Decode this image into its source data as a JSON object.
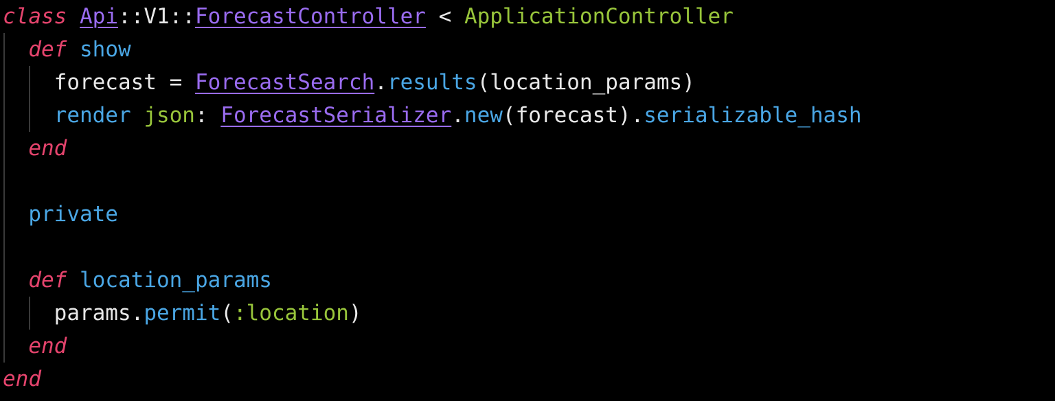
{
  "colors": {
    "background": "#000000",
    "keyword": "#e5446d",
    "constant_link": "#9a6cf0",
    "class_name": "#98c53b",
    "method": "#4aa6e4",
    "plain": "#e8e8e8",
    "indent_guide": "#3a3a3a"
  },
  "code": {
    "l1": {
      "kw": "class",
      "ns1": "Api",
      "sep1": "::V1::",
      "name": "ForecastController",
      "op": " < ",
      "parent": "ApplicationController"
    },
    "l2": {
      "kw": "def",
      "name": "show"
    },
    "l3": {
      "var": "forecast = ",
      "const": "ForecastSearch",
      "dot": ".",
      "method": "results",
      "args": "(location_params)"
    },
    "l4": {
      "method": "render",
      "key": "json",
      "colon": ": ",
      "const": "ForecastSerializer",
      "dot1": ".",
      "new": "new",
      "args": "(forecast)",
      "dot2": ".",
      "method2": "serializable_hash"
    },
    "l5": {
      "kw": "end"
    },
    "l7": {
      "word": "private"
    },
    "l9": {
      "kw": "def",
      "name": "location_params"
    },
    "l10": {
      "recv": "params",
      "dot": ".",
      "method": "permit",
      "open": "(",
      "sym": ":location",
      "close": ")"
    },
    "l11": {
      "kw": "end"
    },
    "l12": {
      "kw": "end"
    }
  }
}
